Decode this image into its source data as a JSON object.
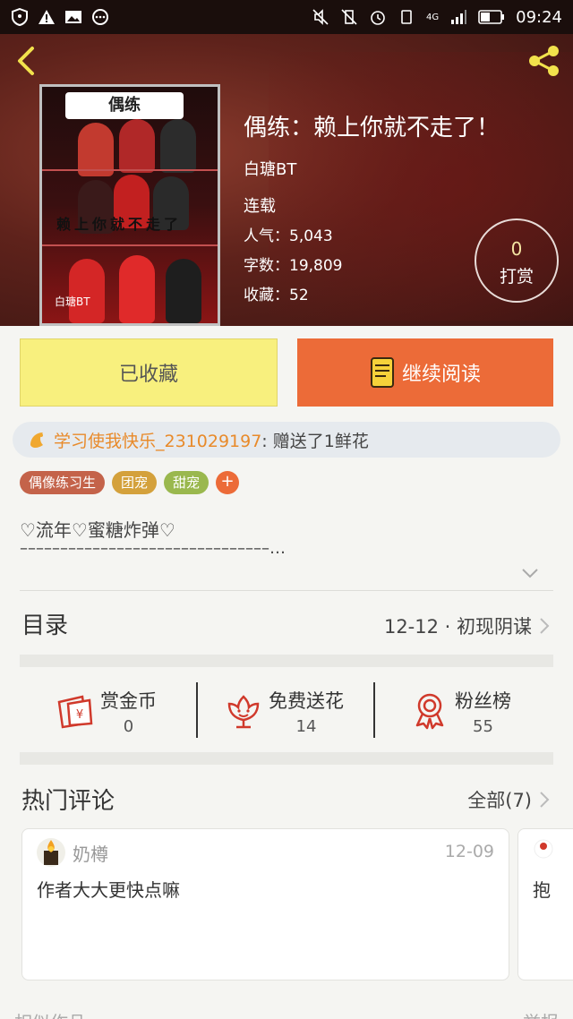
{
  "status_bar": {
    "time": "09:24",
    "network": "4G"
  },
  "book": {
    "title": "偶练：赖上你就不走了！",
    "author": "白瑭BT",
    "status": "连载",
    "popularity_label": "人气：",
    "popularity": "5,043",
    "wordcount_label": "字数：",
    "wordcount": "19,809",
    "favorites_label": "收藏：",
    "favorites": "52",
    "cover_title": "偶练",
    "cover_text": "赖上你就不走了",
    "cover_sign": "白瑭BT"
  },
  "tip": {
    "count": "0",
    "label": "打赏"
  },
  "actions": {
    "collected_label": "已收藏",
    "read_label": "继续阅读"
  },
  "flower_banner": {
    "user": "学习使我快乐_231029197",
    "message": ": 赠送了1鲜花"
  },
  "tags": [
    {
      "label": "偶像练习生",
      "color": "#c4634a"
    },
    {
      "label": "团宠",
      "color": "#d4a13c"
    },
    {
      "label": "甜宠",
      "color": "#9ab84e"
    }
  ],
  "tag_add": "+",
  "intro": {
    "line1": "♡流年♡蜜糖炸弹♡",
    "line2": "–––––––––––––––––––––––––––––––…"
  },
  "catalog": {
    "label": "目录",
    "latest": "12-12 · 初现阴谋"
  },
  "stats": [
    {
      "label": "赏金币",
      "value": "0",
      "icon": "red-envelope-icon"
    },
    {
      "label": "免费送花",
      "value": "14",
      "icon": "flower-icon"
    },
    {
      "label": "粉丝榜",
      "value": "55",
      "icon": "medal-icon"
    }
  ],
  "comments": {
    "label": "热门评论",
    "all_label": "全部(7)",
    "items": [
      {
        "user": "奶樽",
        "date": "12-09",
        "text": "作者大大更快点嘛"
      },
      {
        "user": "",
        "date": "",
        "text": "抱"
      }
    ]
  },
  "bottom": {
    "left": "相似作品",
    "right": "举报"
  },
  "colors": {
    "accent_orange": "#ec6b38",
    "collected_yellow": "#f8f07e",
    "flower_user": "#e88a2a",
    "icon_red": "#d0392b"
  }
}
